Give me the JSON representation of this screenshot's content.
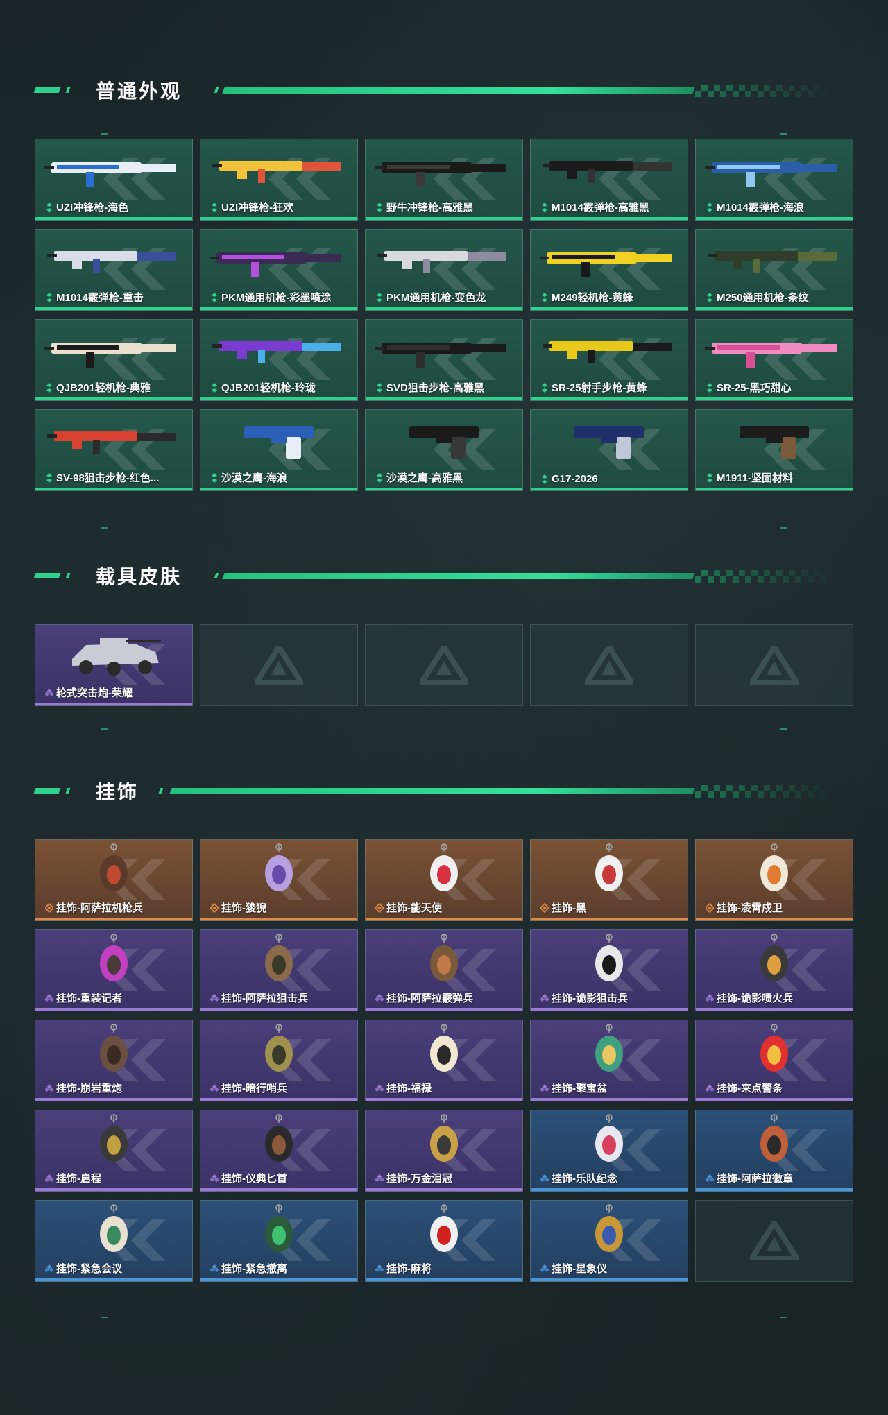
{
  "sections": {
    "skins": {
      "title": "普通外观",
      "items": [
        {
          "label": "UZI冲锋枪-海色",
          "rarity": "green",
          "palette": [
            "#e8eef5",
            "#2a6fd0"
          ]
        },
        {
          "label": "UZI冲锋枪-狂欢",
          "rarity": "green",
          "palette": [
            "#f2c23a",
            "#e0553a"
          ]
        },
        {
          "label": "野牛冲锋枪-高雅黑",
          "rarity": "green",
          "palette": [
            "#1a1a1a",
            "#3a3a3a"
          ]
        },
        {
          "label": "M1014霰弹枪-高雅黑",
          "rarity": "green",
          "palette": [
            "#1b1b1b",
            "#333333"
          ]
        },
        {
          "label": "M1014霰弹枪-海浪",
          "rarity": "green",
          "palette": [
            "#2a5fa8",
            "#8fc7f0"
          ]
        },
        {
          "label": "M1014霰弹枪-重击",
          "rarity": "green",
          "palette": [
            "#d8dde8",
            "#3a4f9a"
          ]
        },
        {
          "label": "PKM通用机枪-彩墨喷涂",
          "rarity": "green",
          "palette": [
            "#3a2b55",
            "#b44fe0"
          ]
        },
        {
          "label": "PKM通用机枪-变色龙",
          "rarity": "green",
          "palette": [
            "#d8d8de",
            "#8e8aa0"
          ]
        },
        {
          "label": "M249轻机枪-黄蜂",
          "rarity": "green",
          "palette": [
            "#f0d020",
            "#1a1a1a"
          ]
        },
        {
          "label": "M250通用机枪-条纹",
          "rarity": "green",
          "palette": [
            "#2f3d2a",
            "#5a6a3a"
          ]
        },
        {
          "label": "QJB201轻机枪-典雅",
          "rarity": "green",
          "palette": [
            "#e8e0cc",
            "#1a1a1a"
          ]
        },
        {
          "label": "QJB201轻机枪-玲珑",
          "rarity": "green",
          "palette": [
            "#7a3cd0",
            "#4ab0e8"
          ]
        },
        {
          "label": "SVD狙击步枪-高雅黑",
          "rarity": "green",
          "palette": [
            "#1a1a1a",
            "#2e2e2e"
          ]
        },
        {
          "label": "SR-25射手步枪-黄蜂",
          "rarity": "green",
          "palette": [
            "#e8c818",
            "#1a1a1a"
          ]
        },
        {
          "label": "SR-25-黑巧甜心",
          "rarity": "green",
          "palette": [
            "#f08cc0",
            "#d84f98"
          ]
        },
        {
          "label": "SV-98狙击步枪-红色...",
          "rarity": "green",
          "palette": [
            "#d84030",
            "#2a2a2a"
          ]
        },
        {
          "label": "沙漠之鹰-海浪",
          "rarity": "green",
          "palette": [
            "#2a5fb8",
            "#e8eef5"
          ]
        },
        {
          "label": "沙漠之鹰-高雅黑",
          "rarity": "green",
          "palette": [
            "#1a1a1a",
            "#383838"
          ]
        },
        {
          "label": "G17-2026",
          "rarity": "green",
          "palette": [
            "#1e2f6a",
            "#c0c8d8"
          ]
        },
        {
          "label": "M1911-坚固材料",
          "rarity": "green",
          "palette": [
            "#1c1c1c",
            "#7a5a3a"
          ]
        }
      ]
    },
    "vehicles": {
      "title": "载具皮肤",
      "items": [
        {
          "label": "轮式突击炮-荣耀",
          "rarity": "purple",
          "palette": [
            "#c8ccd4",
            "#2a2a2a"
          ]
        }
      ],
      "empty_slots": 4
    },
    "charms": {
      "title": "挂饰",
      "items": [
        {
          "label": "挂饰-阿萨拉机枪兵",
          "rarity": "orange",
          "palette": [
            "#5a3a2a",
            "#c04a30"
          ]
        },
        {
          "label": "挂饰-狻猊",
          "rarity": "orange",
          "palette": [
            "#b8a0e0",
            "#6a4aa8"
          ]
        },
        {
          "label": "挂饰-能天使",
          "rarity": "orange",
          "palette": [
            "#f0f0f0",
            "#d83040"
          ]
        },
        {
          "label": "挂饰-黑",
          "rarity": "orange",
          "palette": [
            "#f0f0f0",
            "#c83a3a"
          ]
        },
        {
          "label": "挂饰-凌霄戍卫",
          "rarity": "orange",
          "palette": [
            "#f0e8d8",
            "#e07a30"
          ]
        },
        {
          "label": "挂饰-重装记者",
          "rarity": "purple",
          "palette": [
            "#c040c0",
            "#4a3a3a"
          ]
        },
        {
          "label": "挂饰-阿萨拉狙击兵",
          "rarity": "purple",
          "palette": [
            "#8a6a4a",
            "#3a3a2a"
          ]
        },
        {
          "label": "挂饰-阿萨拉霰弹兵",
          "rarity": "purple",
          "palette": [
            "#7a5a3a",
            "#c07a4a"
          ]
        },
        {
          "label": "挂饰-诡影狙击兵",
          "rarity": "purple",
          "palette": [
            "#e8e8e8",
            "#1a1a1a"
          ]
        },
        {
          "label": "挂饰-诡影喷火兵",
          "rarity": "purple",
          "palette": [
            "#3a3a3a",
            "#e0a040"
          ]
        },
        {
          "label": "挂饰-崩岩重炮",
          "rarity": "purple",
          "palette": [
            "#6a5040",
            "#3a2a20"
          ]
        },
        {
          "label": "挂饰-暗行哨兵",
          "rarity": "purple",
          "palette": [
            "#a09050",
            "#3a3a2a"
          ]
        },
        {
          "label": "挂饰-福禄",
          "rarity": "purple",
          "palette": [
            "#f0e8d0",
            "#2a2a2a"
          ]
        },
        {
          "label": "挂饰-聚宝盆",
          "rarity": "purple",
          "palette": [
            "#40a080",
            "#e8c860"
          ]
        },
        {
          "label": "挂饰-来点警条",
          "rarity": "purple",
          "palette": [
            "#e03030",
            "#f0c040"
          ]
        },
        {
          "label": "挂饰-启程",
          "rarity": "purple",
          "palette": [
            "#3a3a3a",
            "#c0a040"
          ]
        },
        {
          "label": "挂饰-仪典匕首",
          "rarity": "purple",
          "palette": [
            "#2a2a2a",
            "#8a5a3a"
          ]
        },
        {
          "label": "挂饰-万金泪冠",
          "rarity": "purple",
          "palette": [
            "#c8a048",
            "#3a3a3a"
          ]
        },
        {
          "label": "挂饰-乐队纪念",
          "rarity": "blue",
          "palette": [
            "#e8e8f0",
            "#d84060"
          ]
        },
        {
          "label": "挂饰-阿萨拉徽章",
          "rarity": "blue",
          "palette": [
            "#c0603a",
            "#2a2a2a"
          ]
        },
        {
          "label": "挂饰-紧急会议",
          "rarity": "blue",
          "palette": [
            "#e8e0d0",
            "#3a8a60"
          ]
        },
        {
          "label": "挂饰-紧急撤离",
          "rarity": "blue",
          "palette": [
            "#2a5a3a",
            "#40c070"
          ]
        },
        {
          "label": "挂饰-麻将",
          "rarity": "blue",
          "palette": [
            "#f0f0f0",
            "#d02020"
          ]
        },
        {
          "label": "挂饰-星象仪",
          "rarity": "blue",
          "palette": [
            "#c89838",
            "#3a5ab0"
          ]
        }
      ],
      "empty_slots": 1
    }
  },
  "colors": {
    "accent": "#2fd28c",
    "green": "#2fd28c",
    "purple": "#9b7ad6",
    "orange": "#e08a48",
    "blue": "#4a94d6"
  }
}
